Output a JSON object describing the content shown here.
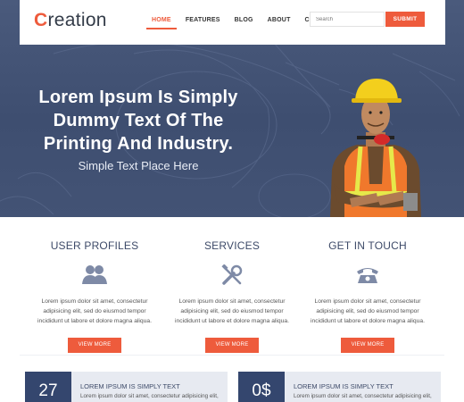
{
  "brand": {
    "logo_initial": "C",
    "logo_rest": "reation",
    "accent_color": "#ee5b3c",
    "navy_color": "#34466e"
  },
  "nav": {
    "items": [
      {
        "label": "HOME",
        "active": true
      },
      {
        "label": "FEATURES",
        "active": false
      },
      {
        "label": "BLOG",
        "active": false
      },
      {
        "label": "ABOUT",
        "active": false
      },
      {
        "label": "CONTACT",
        "active": false
      }
    ],
    "search_placeholder": "Search",
    "submit_label": "SUBMIT"
  },
  "hero": {
    "title": "Lorem Ipsum Is Simply Dummy Text Of The Printing And Industry.",
    "subtitle": "Simple Text Place Here"
  },
  "features": [
    {
      "title": "USER PROFILES",
      "icon": "users-icon",
      "text": "Lorem ipsum dolor sit amet, consectetur adipisicing elit, sed do eiusmod tempor incididunt ut labore et dolore magna aliqua.",
      "button": "VIEW MORE"
    },
    {
      "title": "SERVICES",
      "icon": "tools-icon",
      "text": "Lorem ipsum dolor sit amet, consectetur adipisicing elit, sed do eiusmod tempor incididunt ut labore et dolore magna aliqua.",
      "button": "VIEW MORE"
    },
    {
      "title": "GET IN TOUCH",
      "icon": "phone-icon",
      "text": "Lorem ipsum dolor sit amet, consectetur adipisicing elit, sed do eiusmod tempor incididunt ut labore et dolore magna aliqua.",
      "button": "VIEW MORE"
    }
  ],
  "stats": [
    {
      "number": "27",
      "title": "LOREM IPSUM IS SIMPLY TEXT",
      "text": "Lorem ipsum dolor sit amet, consectetur adipisicing elit,"
    },
    {
      "number": "0$",
      "title": "LOREM IPSUM IS SIMPLY TEXT",
      "text": "Lorem ipsum dolor sit amet, consectetur adipisicing elit,"
    }
  ]
}
